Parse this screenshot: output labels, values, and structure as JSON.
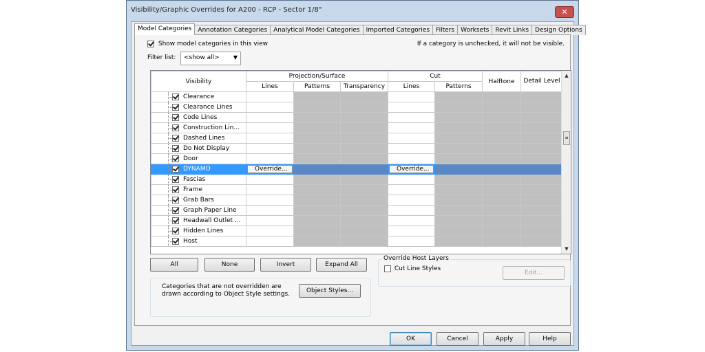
{
  "window": {
    "title": "Visibility/Graphic Overrides for A200 - RCP - Sector 1/8\"",
    "close_glyph": "✕"
  },
  "tabs": [
    {
      "label": "Model Categories",
      "active": true
    },
    {
      "label": "Annotation Categories"
    },
    {
      "label": "Analytical Model Categories"
    },
    {
      "label": "Imported Categories"
    },
    {
      "label": "Filters"
    },
    {
      "label": "Worksets"
    },
    {
      "label": "Revit Links"
    },
    {
      "label": "Design Options"
    }
  ],
  "panel": {
    "show_model_label": "Show model categories in this view",
    "show_model_checked": true,
    "hint": "If a category is unchecked, it will not be visible.",
    "filter_label": "Filter list:",
    "filter_value": "<show all>"
  },
  "grid": {
    "headers": {
      "visibility": "Visibility",
      "projection": "Projection/Surface",
      "cut": "Cut",
      "halftone": "Halftone",
      "detail_level": "Detail Level",
      "lines": "Lines",
      "patterns": "Patterns",
      "transparency": "Transparency",
      "cut_lines": "Lines",
      "cut_patterns": "Patterns"
    },
    "override_label": "Override...",
    "rows": [
      {
        "name": "Clearance",
        "checked": true
      },
      {
        "name": "Clearance Lines",
        "checked": true
      },
      {
        "name": "Code Lines",
        "checked": true
      },
      {
        "name": "Construction Lin...",
        "checked": true
      },
      {
        "name": "Dashed Lines",
        "checked": true
      },
      {
        "name": "Do Not Display",
        "checked": true
      },
      {
        "name": "Door",
        "checked": true
      },
      {
        "name": "DYNAMO",
        "checked": true,
        "selected": true
      },
      {
        "name": "Fascias",
        "checked": true
      },
      {
        "name": "Frame",
        "checked": true
      },
      {
        "name": "Grab Bars",
        "checked": true
      },
      {
        "name": "Graph Paper Line",
        "checked": true
      },
      {
        "name": "Headwall Outlet ...",
        "checked": true
      },
      {
        "name": "Hidden Lines",
        "checked": true
      },
      {
        "name": "Host",
        "checked": true
      }
    ]
  },
  "buttons": {
    "all": "All",
    "none": "None",
    "invert": "Invert",
    "expand_all": "Expand All",
    "object_styles": "Object Styles...",
    "edit": "Edit...",
    "ok": "OK",
    "cancel": "Cancel",
    "apply": "Apply",
    "help": "Help"
  },
  "note": "Categories that are not overridden are drawn according to Object Style settings.",
  "override_host": {
    "legend": "Override Host Layers",
    "cut_line_styles": "Cut Line Styles",
    "checked": false
  },
  "colors": {
    "selection": "#3399ff",
    "gray_cell": "#c0c0c0",
    "frame": "#c9d9ec"
  }
}
